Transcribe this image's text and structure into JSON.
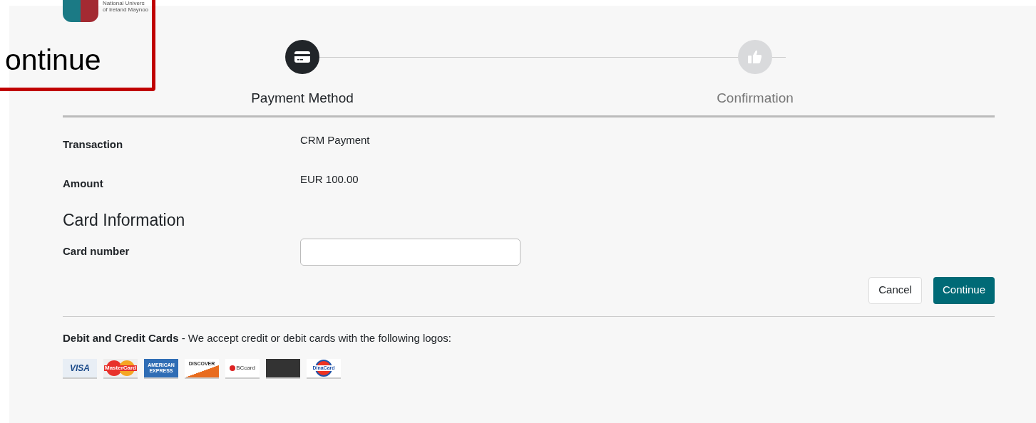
{
  "header": {
    "logo_lines": [
      "National Univers",
      "of Ireland Maynoo"
    ]
  },
  "callout": {
    "text": "ontinue"
  },
  "steps": [
    {
      "label": "Payment Method",
      "kind": "card",
      "active": true
    },
    {
      "label": "Confirmation",
      "kind": "thumb",
      "active": false
    }
  ],
  "details": [
    {
      "label": "Transaction",
      "value": "CRM Payment"
    },
    {
      "label": "Amount",
      "value": "EUR 100.00"
    }
  ],
  "card_section": {
    "heading": "Card Information",
    "field_label": "Card number"
  },
  "buttons": [
    {
      "label": "Cancel",
      "kind": "secondary"
    },
    {
      "label": "Continue",
      "kind": "primary"
    }
  ],
  "accepted": {
    "text": "**Debit and Credit Cards** - We accept credit or debit cards with the following logos:"
  },
  "card_logos": [
    {
      "kind": "visa",
      "text": "VISA"
    },
    {
      "kind": "mastercard",
      "text": "MasterCard"
    },
    {
      "kind": "amex",
      "text": "AMERICAN EXPRESS"
    },
    {
      "kind": "discover",
      "text": "DISCOVER"
    },
    {
      "kind": "bccard",
      "text": "BCcard"
    },
    {
      "kind": "dark"
    },
    {
      "kind": "dinacard",
      "text": "DinaCard"
    }
  ]
}
